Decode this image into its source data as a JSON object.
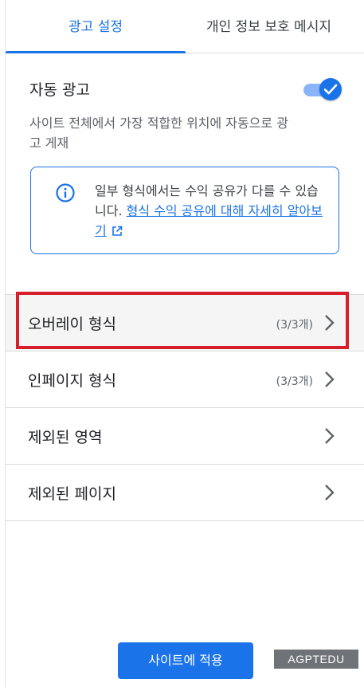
{
  "tabs": [
    {
      "label": "광고 설정",
      "active": true
    },
    {
      "label": "개인 정보 보호 메시지",
      "active": false
    }
  ],
  "auto_ads": {
    "title": "자동 광고",
    "enabled": true,
    "description": "사이트 전체에서 가장 적합한 위치에 자동으로 광고 게재"
  },
  "info": {
    "icon": "info-icon",
    "text": "일부 형식에서는 수익 공유가 다를 수 있습니다.",
    "link_text": "형식 수익 공유에 대해 자세히 알아보기",
    "link_icon": "open-in-new-icon"
  },
  "list_items": [
    {
      "label": "오버레이 형식",
      "count": "(3/3개)",
      "highlighted": true
    },
    {
      "label": "인페이지 형식",
      "count": "(3/3개)",
      "highlighted": false
    },
    {
      "label": "제외된 영역",
      "count": "",
      "highlighted": false
    },
    {
      "label": "제외된 페이지",
      "count": "",
      "highlighted": false
    }
  ],
  "apply_button": {
    "label": "사이트에 적용"
  },
  "watermark": {
    "text": "AGPTEDU"
  },
  "colors": {
    "accent": "#1a73e8",
    "highlight_frame": "#d61f2a"
  }
}
